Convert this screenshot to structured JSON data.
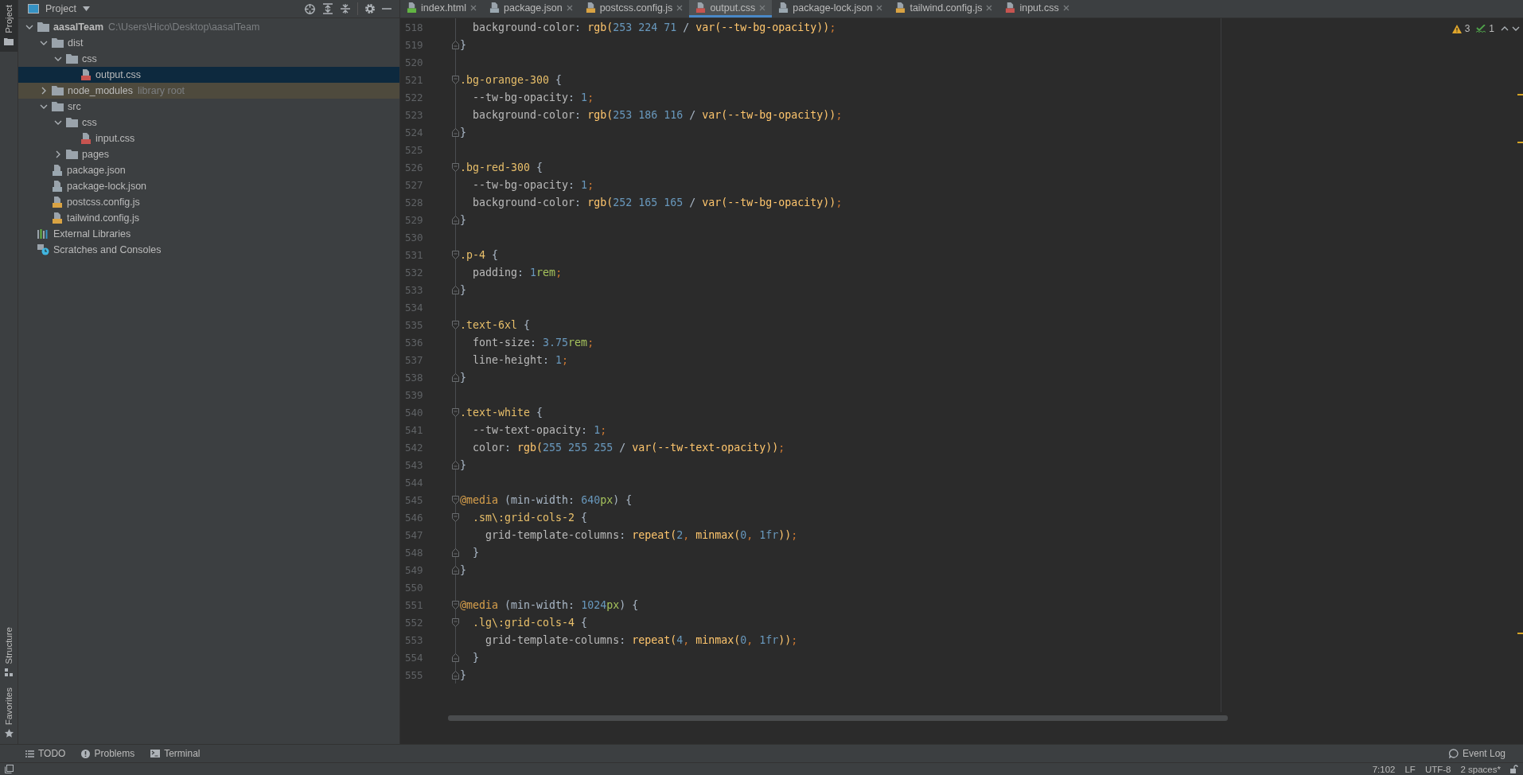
{
  "left_stripe": {
    "top": [
      {
        "label": "Project",
        "selected": true
      }
    ],
    "bottom": [
      {
        "label": "Structure",
        "selected": false
      },
      {
        "label": "Favorites",
        "selected": false
      }
    ]
  },
  "project_panel": {
    "title": "Project",
    "tree": [
      {
        "label": "aasalTeam",
        "hint": "C:\\Users\\Hico\\Desktop\\aasalTeam",
        "kind": "folder",
        "expanded": true,
        "selected": false,
        "library_root": false,
        "children": [
          {
            "label": "dist",
            "kind": "folder",
            "expanded": true,
            "selected": false,
            "library_root": false,
            "children": [
              {
                "label": "css",
                "kind": "folder",
                "expanded": true,
                "selected": false,
                "library_root": false,
                "children": [
                  {
                    "label": "output.css",
                    "kind": "css",
                    "selected": true,
                    "library_root": false
                  }
                ]
              }
            ]
          },
          {
            "label": "node_modules",
            "hint": "library root",
            "kind": "folder",
            "expanded": false,
            "selected": false,
            "library_root": true
          },
          {
            "label": "src",
            "kind": "folder",
            "expanded": true,
            "selected": false,
            "library_root": false,
            "children": [
              {
                "label": "css",
                "kind": "folder",
                "expanded": true,
                "selected": false,
                "library_root": false,
                "children": [
                  {
                    "label": "input.css",
                    "kind": "css",
                    "selected": false,
                    "library_root": false
                  }
                ]
              },
              {
                "label": "pages",
                "kind": "folder",
                "expanded": false,
                "selected": false,
                "library_root": false
              }
            ]
          },
          {
            "label": "package.json",
            "kind": "json",
            "selected": false,
            "library_root": false
          },
          {
            "label": "package-lock.json",
            "kind": "json",
            "selected": false,
            "library_root": false
          },
          {
            "label": "postcss.config.js",
            "kind": "js",
            "selected": false,
            "library_root": false
          },
          {
            "label": "tailwind.config.js",
            "kind": "js",
            "selected": false,
            "library_root": false
          }
        ]
      },
      {
        "label": "External Libraries",
        "kind": "libraries",
        "selected": false,
        "library_root": false
      },
      {
        "label": "Scratches and Consoles",
        "kind": "scratches",
        "selected": false,
        "library_root": false
      }
    ]
  },
  "tabs": [
    {
      "label": "index.html",
      "kind": "html",
      "selected": false
    },
    {
      "label": "package.json",
      "kind": "json",
      "selected": false
    },
    {
      "label": "postcss.config.js",
      "kind": "js",
      "selected": false
    },
    {
      "label": "output.css",
      "kind": "css",
      "selected": true
    },
    {
      "label": "package-lock.json",
      "kind": "json",
      "selected": false
    },
    {
      "label": "tailwind.config.js",
      "kind": "js",
      "selected": false
    },
    {
      "label": "input.css",
      "kind": "css",
      "selected": false
    }
  ],
  "inspections": {
    "warnings": "3",
    "weak_warnings": "1"
  },
  "code_lines": [
    {
      "n": "518",
      "kind": "plain",
      "tokens": [
        {
          "t": "  background-color",
          "kind": "property"
        },
        {
          "t": ": ",
          "kind": "plain"
        },
        {
          "t": "rgb(",
          "kind": "function"
        },
        {
          "t": "253 224 71",
          "kind": "number"
        },
        {
          "t": " / ",
          "kind": "plain"
        },
        {
          "t": "var(--tw-bg-opacity))",
          "kind": "function"
        },
        {
          "t": ";",
          "kind": "separator"
        }
      ]
    },
    {
      "n": "519",
      "kind": "fold-end",
      "tokens": [
        {
          "t": "}",
          "kind": "plain"
        }
      ]
    },
    {
      "n": "520",
      "kind": "plain"
    },
    {
      "n": "521",
      "kind": "fold-start",
      "tokens": [
        {
          "t": ".bg-orange-300",
          "kind": "selector"
        },
        {
          "t": " {",
          "kind": "plain"
        }
      ]
    },
    {
      "n": "522",
      "kind": "plain",
      "tokens": [
        {
          "t": "  --tw-bg-opacity",
          "kind": "property"
        },
        {
          "t": ": ",
          "kind": "plain"
        },
        {
          "t": "1",
          "kind": "number"
        },
        {
          "t": ";",
          "kind": "separator"
        }
      ]
    },
    {
      "n": "523",
      "kind": "plain",
      "tokens": [
        {
          "t": "  background-color",
          "kind": "property"
        },
        {
          "t": ": ",
          "kind": "plain"
        },
        {
          "t": "rgb(",
          "kind": "function"
        },
        {
          "t": "253 186 116",
          "kind": "number"
        },
        {
          "t": " / ",
          "kind": "plain"
        },
        {
          "t": "var(--tw-bg-opacity))",
          "kind": "function"
        },
        {
          "t": ";",
          "kind": "separator"
        }
      ]
    },
    {
      "n": "524",
      "kind": "fold-end",
      "tokens": [
        {
          "t": "}",
          "kind": "plain"
        }
      ]
    },
    {
      "n": "525",
      "kind": "plain"
    },
    {
      "n": "526",
      "kind": "fold-start",
      "tokens": [
        {
          "t": ".bg-red-300",
          "kind": "selector"
        },
        {
          "t": " {",
          "kind": "plain"
        }
      ]
    },
    {
      "n": "527",
      "kind": "plain",
      "tokens": [
        {
          "t": "  --tw-bg-opacity",
          "kind": "property"
        },
        {
          "t": ": ",
          "kind": "plain"
        },
        {
          "t": "1",
          "kind": "number"
        },
        {
          "t": ";",
          "kind": "separator"
        }
      ]
    },
    {
      "n": "528",
      "kind": "plain",
      "tokens": [
        {
          "t": "  background-color",
          "kind": "property"
        },
        {
          "t": ": ",
          "kind": "plain"
        },
        {
          "t": "rgb(",
          "kind": "function"
        },
        {
          "t": "252 165 165",
          "kind": "number"
        },
        {
          "t": " / ",
          "kind": "plain"
        },
        {
          "t": "var(--tw-bg-opacity))",
          "kind": "function"
        },
        {
          "t": ";",
          "kind": "separator"
        }
      ]
    },
    {
      "n": "529",
      "kind": "fold-end",
      "tokens": [
        {
          "t": "}",
          "kind": "plain"
        }
      ]
    },
    {
      "n": "530",
      "kind": "plain"
    },
    {
      "n": "531",
      "kind": "fold-start",
      "tokens": [
        {
          "t": ".p-4",
          "kind": "selector"
        },
        {
          "t": " {",
          "kind": "plain"
        }
      ]
    },
    {
      "n": "532",
      "kind": "plain",
      "tokens": [
        {
          "t": "  padding",
          "kind": "property"
        },
        {
          "t": ": ",
          "kind": "plain"
        },
        {
          "t": "1",
          "kind": "number"
        },
        {
          "t": "rem",
          "kind": "unit"
        },
        {
          "t": ";",
          "kind": "separator"
        }
      ]
    },
    {
      "n": "533",
      "kind": "fold-end",
      "tokens": [
        {
          "t": "}",
          "kind": "plain"
        }
      ]
    },
    {
      "n": "534",
      "kind": "plain"
    },
    {
      "n": "535",
      "kind": "fold-start",
      "tokens": [
        {
          "t": ".text-6xl",
          "kind": "selector"
        },
        {
          "t": " {",
          "kind": "plain"
        }
      ]
    },
    {
      "n": "536",
      "kind": "plain",
      "tokens": [
        {
          "t": "  font-size",
          "kind": "property"
        },
        {
          "t": ": ",
          "kind": "plain"
        },
        {
          "t": "3.75",
          "kind": "number"
        },
        {
          "t": "rem",
          "kind": "unit"
        },
        {
          "t": ";",
          "kind": "separator"
        }
      ]
    },
    {
      "n": "537",
      "kind": "plain",
      "tokens": [
        {
          "t": "  line-height",
          "kind": "property"
        },
        {
          "t": ": ",
          "kind": "plain"
        },
        {
          "t": "1",
          "kind": "number"
        },
        {
          "t": ";",
          "kind": "separator"
        }
      ]
    },
    {
      "n": "538",
      "kind": "fold-end",
      "tokens": [
        {
          "t": "}",
          "kind": "plain"
        }
      ]
    },
    {
      "n": "539",
      "kind": "plain"
    },
    {
      "n": "540",
      "kind": "fold-start",
      "tokens": [
        {
          "t": ".text-white",
          "kind": "selector"
        },
        {
          "t": " {",
          "kind": "plain"
        }
      ]
    },
    {
      "n": "541",
      "kind": "plain",
      "tokens": [
        {
          "t": "  --tw-text-opacity",
          "kind": "property"
        },
        {
          "t": ": ",
          "kind": "plain"
        },
        {
          "t": "1",
          "kind": "number"
        },
        {
          "t": ";",
          "kind": "separator"
        }
      ]
    },
    {
      "n": "542",
      "kind": "plain",
      "tokens": [
        {
          "t": "  color",
          "kind": "property"
        },
        {
          "t": ": ",
          "kind": "plain"
        },
        {
          "t": "rgb(",
          "kind": "function"
        },
        {
          "t": "255 255 255",
          "kind": "number"
        },
        {
          "t": " / ",
          "kind": "plain"
        },
        {
          "t": "var(--tw-text-opacity))",
          "kind": "function"
        },
        {
          "t": ";",
          "kind": "separator"
        }
      ]
    },
    {
      "n": "543",
      "kind": "fold-end",
      "tokens": [
        {
          "t": "}",
          "kind": "plain"
        }
      ]
    },
    {
      "n": "544",
      "kind": "plain"
    },
    {
      "n": "545",
      "kind": "fold-start",
      "tokens": [
        {
          "t": "@media",
          "kind": "keyword"
        },
        {
          "t": " (min-width: ",
          "kind": "plain"
        },
        {
          "t": "640",
          "kind": "number"
        },
        {
          "t": "px",
          "kind": "unit"
        },
        {
          "t": ") {",
          "kind": "plain"
        }
      ]
    },
    {
      "n": "546",
      "kind": "fold-start",
      "tokens": [
        {
          "t": "  .sm\\:grid-cols-2",
          "kind": "selector"
        },
        {
          "t": " {",
          "kind": "plain"
        }
      ]
    },
    {
      "n": "547",
      "kind": "plain",
      "tokens": [
        {
          "t": "    grid-template-columns",
          "kind": "property"
        },
        {
          "t": ": ",
          "kind": "plain"
        },
        {
          "t": "repeat(",
          "kind": "function"
        },
        {
          "t": "2",
          "kind": "number"
        },
        {
          "t": ", ",
          "kind": "separator"
        },
        {
          "t": "minmax(",
          "kind": "function"
        },
        {
          "t": "0",
          "kind": "number"
        },
        {
          "t": ", ",
          "kind": "separator"
        },
        {
          "t": "1fr",
          "kind": "number"
        },
        {
          "t": "))",
          "kind": "function"
        },
        {
          "t": ";",
          "kind": "separator"
        }
      ]
    },
    {
      "n": "548",
      "kind": "fold-end",
      "tokens": [
        {
          "t": "  }",
          "kind": "plain"
        }
      ]
    },
    {
      "n": "549",
      "kind": "fold-end",
      "tokens": [
        {
          "t": "}",
          "kind": "plain"
        }
      ]
    },
    {
      "n": "550",
      "kind": "plain"
    },
    {
      "n": "551",
      "kind": "fold-start",
      "tokens": [
        {
          "t": "@media",
          "kind": "keyword"
        },
        {
          "t": " (min-width: ",
          "kind": "plain"
        },
        {
          "t": "1024",
          "kind": "number"
        },
        {
          "t": "px",
          "kind": "unit"
        },
        {
          "t": ") {",
          "kind": "plain"
        }
      ]
    },
    {
      "n": "552",
      "kind": "fold-start",
      "tokens": [
        {
          "t": "  .lg\\:grid-cols-4",
          "kind": "selector"
        },
        {
          "t": " {",
          "kind": "plain"
        }
      ]
    },
    {
      "n": "553",
      "kind": "plain",
      "tokens": [
        {
          "t": "    grid-template-columns",
          "kind": "property"
        },
        {
          "t": ": ",
          "kind": "plain"
        },
        {
          "t": "repeat(",
          "kind": "function"
        },
        {
          "t": "4",
          "kind": "number"
        },
        {
          "t": ", ",
          "kind": "separator"
        },
        {
          "t": "minmax(",
          "kind": "function"
        },
        {
          "t": "0",
          "kind": "number"
        },
        {
          "t": ", ",
          "kind": "separator"
        },
        {
          "t": "1fr",
          "kind": "number"
        },
        {
          "t": "))",
          "kind": "function"
        },
        {
          "t": ";",
          "kind": "separator"
        }
      ]
    },
    {
      "n": "554",
      "kind": "fold-end",
      "tokens": [
        {
          "t": "  }",
          "kind": "plain"
        }
      ]
    },
    {
      "n": "555",
      "kind": "fold-end",
      "tokens": [
        {
          "t": "}",
          "kind": "plain"
        }
      ]
    }
  ],
  "tool_windows": [
    {
      "label": "TODO",
      "kind": "todo"
    },
    {
      "label": "Problems",
      "kind": "problems"
    },
    {
      "label": "Terminal",
      "kind": "terminal"
    }
  ],
  "event_log": "Event Log",
  "status_bar": {
    "position": "7:102",
    "line_separator": "LF",
    "encoding": "UTF-8",
    "indent": "2 spaces*"
  }
}
